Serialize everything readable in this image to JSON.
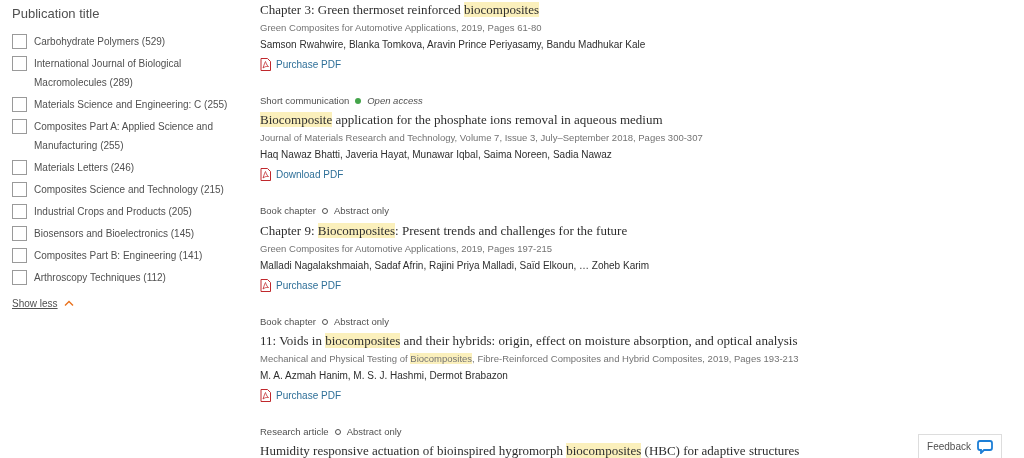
{
  "filter": {
    "title": "Publication title",
    "options": [
      {
        "label": "Carbohydrate Polymers (529)",
        "checked": false
      },
      {
        "label": "International Journal of Biological Macromolecules (289)",
        "checked": false
      },
      {
        "label": "Materials Science and Engineering: C (255)",
        "checked": false
      },
      {
        "label": "Composites Part A: Applied Science and Manufacturing (255)",
        "checked": false
      },
      {
        "label": "Materials Letters (246)",
        "checked": false
      },
      {
        "label": "Composites Science and Technology (215)",
        "checked": false
      },
      {
        "label": "Industrial Crops and Products (205)",
        "checked": false
      },
      {
        "label": "Biosensors and Bioelectronics (145)",
        "checked": false
      },
      {
        "label": "Composites Part B: Engineering (141)",
        "checked": false
      },
      {
        "label": "Arthroscopy Techniques (112)",
        "checked": false
      }
    ],
    "toggle": "Show less"
  },
  "results": [
    {
      "title": [
        {
          "text": "Chapter 3: Green thermoset reinforced ",
          "highlight": false
        },
        {
          "text": "biocomposites",
          "highlight": true
        }
      ],
      "source": [
        {
          "text": "Green Composites for Automotive Applications, 2019, Pages 61-80",
          "highlight": false
        }
      ],
      "authors": "Samson Rwahwire, Blanka Tomkova, Aravin Prince Periyasamy, Bandu Madhukar Kale",
      "link": "Purchase PDF"
    },
    {
      "type": "Short communication",
      "access": {
        "kind": "open",
        "label": "Open access"
      },
      "title": [
        {
          "text": "Biocomposite",
          "highlight": true
        },
        {
          "text": " application for the phosphate ions removal in aqueous medium",
          "highlight": false
        }
      ],
      "source": [
        {
          "text": "Journal of Materials Research and Technology, Volume 7, Issue 3, July–September 2018, Pages 300-307",
          "highlight": false
        }
      ],
      "authors": "Haq Nawaz Bhatti, Javeria Hayat, Munawar Iqbal, Saima Noreen, Sadia Nawaz",
      "link": "Download PDF"
    },
    {
      "type": "Book chapter",
      "access": {
        "kind": "abstract",
        "label": "Abstract only"
      },
      "title": [
        {
          "text": "Chapter 9: ",
          "highlight": false
        },
        {
          "text": "Biocomposites",
          "highlight": true
        },
        {
          "text": ": Present trends and challenges for the future",
          "highlight": false
        }
      ],
      "source": [
        {
          "text": "Green Composites for Automotive Applications, 2019, Pages 197-215",
          "highlight": false
        }
      ],
      "authors": "Malladi Nagalakshmaiah, Sadaf Afrin, Rajini Priya Malladi, Saïd Elkoun, … Zoheb Karim",
      "link": "Purchase PDF"
    },
    {
      "type": "Book chapter",
      "access": {
        "kind": "abstract",
        "label": "Abstract only"
      },
      "title": [
        {
          "text": "11: Voids in ",
          "highlight": false
        },
        {
          "text": "biocomposites",
          "highlight": true
        },
        {
          "text": " and their hybrids: origin, effect on moisture absorption, and optical analysis",
          "highlight": false
        }
      ],
      "source": [
        {
          "text": "Mechanical and Physical Testing of ",
          "highlight": false
        },
        {
          "text": "Biocomposites",
          "highlight": true
        },
        {
          "text": ", Fibre-Reinforced Composites and Hybrid Composites, 2019, Pages 193-213",
          "highlight": false
        }
      ],
      "authors": "M. A. Azmah Hanim, M. S. J. Hashmi, Dermot Brabazon",
      "link": "Purchase PDF"
    },
    {
      "type": "Research article",
      "access": {
        "kind": "abstract",
        "label": "Abstract only"
      },
      "title": [
        {
          "text": "Humidity responsive actuation of bioinspired hygromorph ",
          "highlight": false
        },
        {
          "text": "biocomposites",
          "highlight": true
        },
        {
          "text": " (HBC) for adaptive structures",
          "highlight": false
        }
      ]
    }
  ],
  "feedback": "Feedback"
}
